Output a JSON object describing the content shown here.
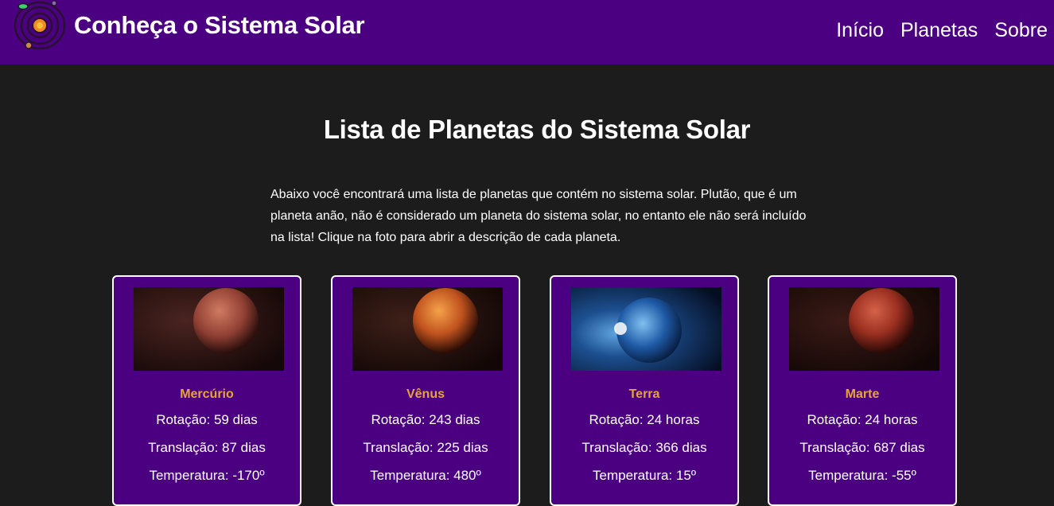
{
  "header": {
    "title": "Conheça o Sistema Solar",
    "logo_icon": "solar-system-icon",
    "nav": [
      {
        "label": "Início"
      },
      {
        "label": "Planetas"
      },
      {
        "label": "Sobre"
      }
    ]
  },
  "main": {
    "title": "Lista de Planetas do Sistema Solar",
    "intro": "Abaixo você encontrará uma lista de planetas que contém no sistema solar. Plutão, que é um planeta anão, não é considerado um planeta do sistema solar, no entanto ele não será incluído na lista! Clique na foto para abrir a descrição de cada planeta.",
    "planets": [
      {
        "name": "Mercúrio",
        "rotation": "Rotação: 59 dias",
        "translation": "Translação: 87 dias",
        "temperature": "Temperatura: -170º"
      },
      {
        "name": "Vênus",
        "rotation": "Rotação: 243 dias",
        "translation": "Translação: 225 dias",
        "temperature": "Temperatura: 480º"
      },
      {
        "name": "Terra",
        "rotation": "Rotação: 24 horas",
        "translation": "Translação: 366 dias",
        "temperature": "Temperatura: 15º"
      },
      {
        "name": "Marte",
        "rotation": "Rotação: 24 horas",
        "translation": "Translação: 687 dias",
        "temperature": "Temperatura: -55º"
      }
    ]
  },
  "colors": {
    "header_bg": "#4b0082",
    "page_bg": "#1c1c1c",
    "card_bg": "#4b0082",
    "planet_name": "#e8a33a"
  }
}
